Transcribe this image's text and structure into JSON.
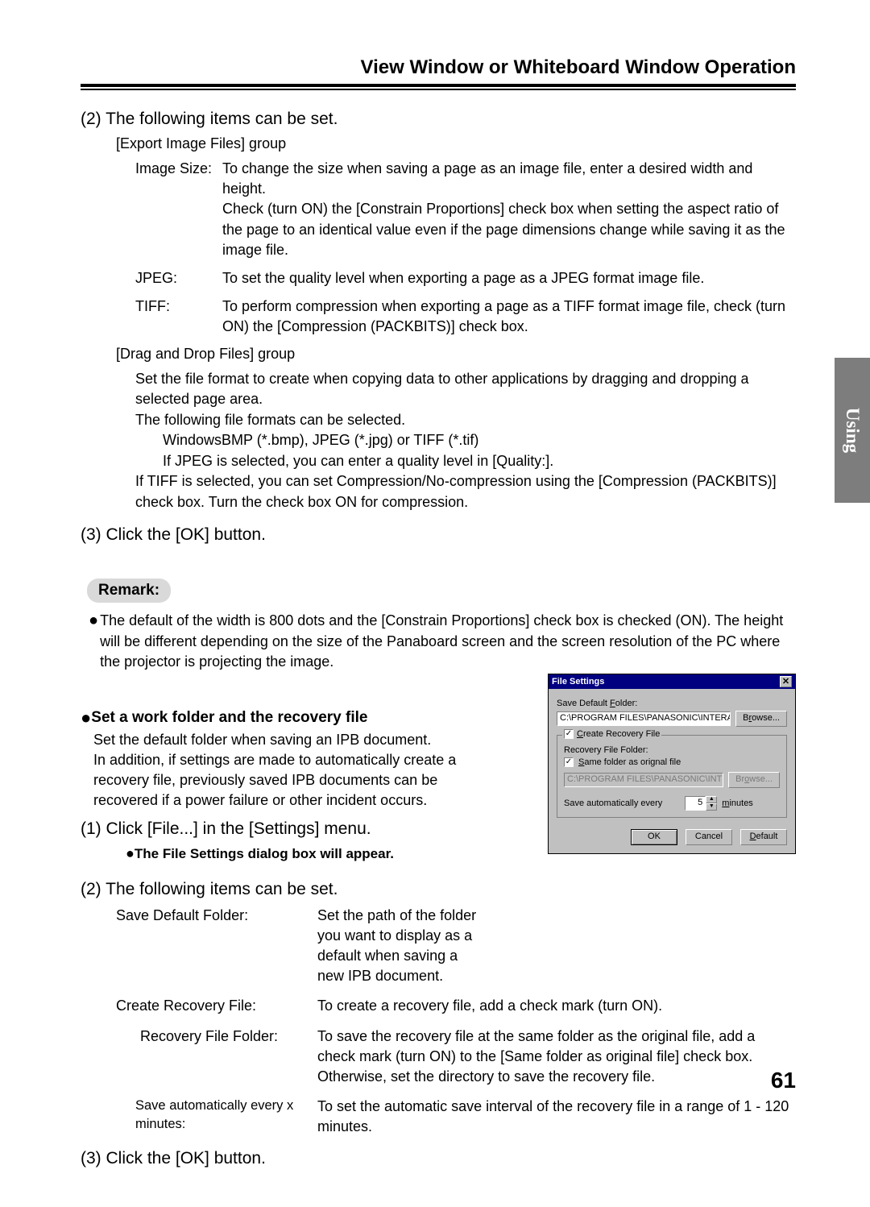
{
  "header": "View Window or Whiteboard Window Operation",
  "sideTab": "Using",
  "step2": "(2) The following items can be set.",
  "export_group": "[Export Image Files] group",
  "export": {
    "imageSizeLabel": "Image Size:",
    "imageSize": "To change the size when saving a page as an image file, enter a desired width and height.\nCheck (turn ON) the [Constrain Proportions] check box when setting the aspect ratio of the page to an identical value even if the page dimensions change while saving it as the image file.",
    "jpegLabel": "JPEG:",
    "jpeg": "To set the quality level when exporting a page as a JPEG format image file.",
    "tiffLabel": "TIFF:",
    "tiff": "To perform compression when exporting a page as a TIFF format image file, check (turn ON) the [Compression (PACKBITS)] check box."
  },
  "drag_group": "[Drag and Drop Files] group",
  "drag_lines": {
    "l1": "Set the file format to create when copying data to other applications by dragging and dropping a selected page area.",
    "l2": "The following file formats can be selected.",
    "l3": "WindowsBMP (*.bmp), JPEG (*.jpg) or TIFF (*.tif)",
    "l4": "If JPEG is selected, you can enter a quality level in [Quality:].",
    "l5": "If TIFF is selected, you can set Compression/No-compression using the [Compression (PACKBITS)] check box. Turn the check box ON for compression."
  },
  "step3": "(3) Click the [OK] button.",
  "remarkLabel": "Remark:",
  "remarkText": "The default of the width is 800 dots and the [Constrain Proportions] check box is checked (ON). The height will be different depending on the size of the Panaboard screen and the screen resolution of the PC where the projector is projecting the image.",
  "section2": "Set a work folder and the recovery file",
  "section2intro": "Set the default folder when saving an IPB document.\nIn addition, if settings are made to automatically create a recovery file, previously saved IPB documents can be recovered if a power failure or other incident occurs.",
  "s2step1": "(1) Click [File...] in the [Settings] menu.",
  "s2step1sub": "The File Settings dialog box will appear.",
  "s2step2": "(2) The following items can be set.",
  "fs": {
    "title": "File Settings",
    "saveDefaultLabel": "Save Default Folder:",
    "path1": "C:\\PROGRAM FILES\\PANASONIC\\INTERAC",
    "browse": "Browse...",
    "createRecovery": "Create Recovery File",
    "recoveryFolderLabel": "Recovery File Folder:",
    "sameFolder": "Same folder as orignal file",
    "path2": "C:\\PROGRAM FILES\\PANASONIC\\INTERAC",
    "autoEveryPre": "Save automatically every",
    "autoVal": "5",
    "autoEveryPost": "minutes",
    "ok": "OK",
    "cancel": "Cancel",
    "default": "Default"
  },
  "defs2": {
    "sdfLabel": "Save Default Folder:",
    "sdf": "Set the path of the folder you want to display as a default when saving a new IPB document.",
    "crfLabel": "Create Recovery File:",
    "crf": "To create a recovery file, add a check mark (turn ON).",
    "rffLabel": "Recovery File Folder:",
    "rff": "To save the recovery file at the same folder as the original file, add a check mark (turn ON) to the [Same folder as original file] check box. Otherwise, set the directory to save the recovery file.",
    "autoLabel": "Save automatically every x minutes:",
    "auto": "To set the automatic save interval of the recovery file in a range of 1 - 120 minutes."
  },
  "s2step3": "(3) Click the [OK] button.",
  "pageNum": "61"
}
